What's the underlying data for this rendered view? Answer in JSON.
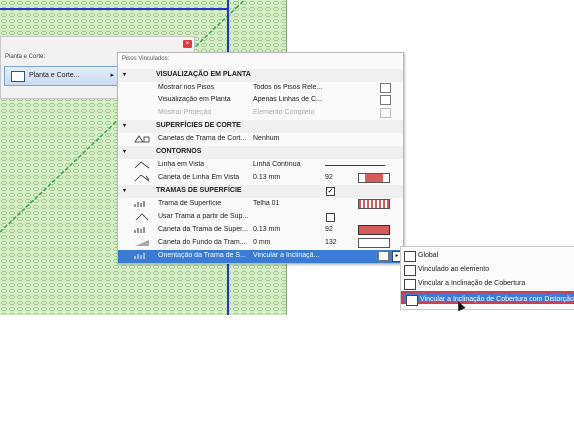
{
  "left_panel": {
    "section_label": "Planta e Corte:",
    "button_label": "Planta e Corte..."
  },
  "settings": {
    "header": "Pisos Vinculados:",
    "rows": [
      {
        "kind": "group",
        "caret": "▾",
        "label": "VISUALIZAÇÃO EM PLANTA"
      },
      {
        "kind": "item",
        "name": "Mostrar nos Pisos",
        "value": "Todos os Pisos Rele..."
      },
      {
        "kind": "item",
        "name": "Visualização em Planta",
        "value": "Apenas Linhas de C..."
      },
      {
        "kind": "item",
        "name": "Mostrar Projeção",
        "value": "Elemento Completo",
        "dim": true
      },
      {
        "kind": "group",
        "caret": "▾",
        "label": "SUPERFÍCIES DE CORTE"
      },
      {
        "kind": "item",
        "name": "Canetas de Trama de Cort...",
        "value": "Nenhum"
      },
      {
        "kind": "group",
        "caret": "▾",
        "label": "CONTORNOS"
      },
      {
        "kind": "item",
        "name": "Linha em Vista",
        "value": "Linha Contínua"
      },
      {
        "kind": "item",
        "name": "Caneta de Linha Em Vista",
        "value": "0.13 mm",
        "value2": "92"
      },
      {
        "kind": "group",
        "caret": "▾",
        "label": "TRAMAS DE SUPERFÍCIE"
      },
      {
        "kind": "item",
        "name": "Trama de Superfície",
        "value": "Telha 01"
      },
      {
        "kind": "item",
        "name": "Usar Trama a partir de Sup...",
        "value": ""
      },
      {
        "kind": "item",
        "name": "Caneta da Trama de Super...",
        "value": "0.13 mm",
        "value2": "92"
      },
      {
        "kind": "item",
        "name": "Caneta do Fundo da Tram...",
        "value": "0 mm",
        "value2": "132"
      },
      {
        "kind": "item",
        "name": "Orientação da Trama de S...",
        "value": "Vincular a Inclinaçã...",
        "selected": true
      }
    ]
  },
  "popup": {
    "items": [
      {
        "label": "Global"
      },
      {
        "label": "Vinculado ao elemento"
      },
      {
        "label": "Vincular a Inclinação de Cobertura"
      },
      {
        "label": "Vincular a Inclinação de Cobertura com Distorção",
        "selected": true
      }
    ]
  },
  "colors": {
    "accent": "#3a7bd5",
    "highlight_border": "#d03c54",
    "canvas_fill": "#d4f0c4",
    "marker_blue": "#1f35d9",
    "diagonal_green": "#3aa84a"
  }
}
